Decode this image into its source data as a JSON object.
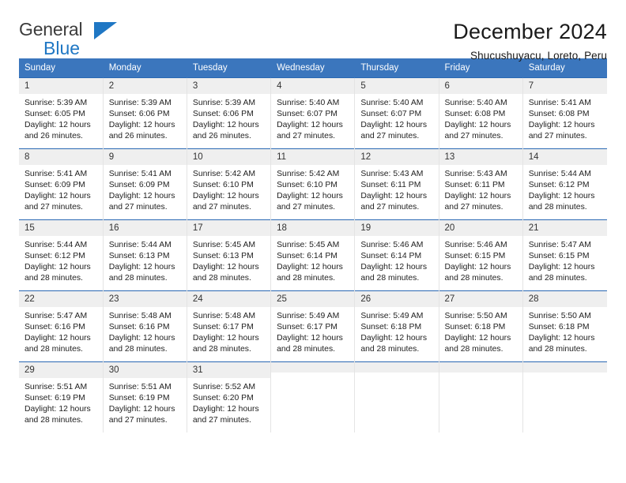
{
  "brand": {
    "name_top": "General",
    "name_bottom": "Blue",
    "accent_color": "#1f77c4"
  },
  "header": {
    "title": "December 2024",
    "subtitle": "Shucushuyacu, Loreto, Peru"
  },
  "theme": {
    "header_row_bg": "#3b76bd",
    "header_row_text": "#ffffff",
    "row_top_border": "#2a68b3",
    "daynum_bg": "#efefef"
  },
  "calendar": {
    "weekday_headers": [
      "Sunday",
      "Monday",
      "Tuesday",
      "Wednesday",
      "Thursday",
      "Friday",
      "Saturday"
    ],
    "weeks": [
      [
        {
          "day": "1",
          "sunrise": "Sunrise: 5:39 AM",
          "sunset": "Sunset: 6:05 PM",
          "daylight": "Daylight: 12 hours and 26 minutes."
        },
        {
          "day": "2",
          "sunrise": "Sunrise: 5:39 AM",
          "sunset": "Sunset: 6:06 PM",
          "daylight": "Daylight: 12 hours and 26 minutes."
        },
        {
          "day": "3",
          "sunrise": "Sunrise: 5:39 AM",
          "sunset": "Sunset: 6:06 PM",
          "daylight": "Daylight: 12 hours and 26 minutes."
        },
        {
          "day": "4",
          "sunrise": "Sunrise: 5:40 AM",
          "sunset": "Sunset: 6:07 PM",
          "daylight": "Daylight: 12 hours and 27 minutes."
        },
        {
          "day": "5",
          "sunrise": "Sunrise: 5:40 AM",
          "sunset": "Sunset: 6:07 PM",
          "daylight": "Daylight: 12 hours and 27 minutes."
        },
        {
          "day": "6",
          "sunrise": "Sunrise: 5:40 AM",
          "sunset": "Sunset: 6:08 PM",
          "daylight": "Daylight: 12 hours and 27 minutes."
        },
        {
          "day": "7",
          "sunrise": "Sunrise: 5:41 AM",
          "sunset": "Sunset: 6:08 PM",
          "daylight": "Daylight: 12 hours and 27 minutes."
        }
      ],
      [
        {
          "day": "8",
          "sunrise": "Sunrise: 5:41 AM",
          "sunset": "Sunset: 6:09 PM",
          "daylight": "Daylight: 12 hours and 27 minutes."
        },
        {
          "day": "9",
          "sunrise": "Sunrise: 5:41 AM",
          "sunset": "Sunset: 6:09 PM",
          "daylight": "Daylight: 12 hours and 27 minutes."
        },
        {
          "day": "10",
          "sunrise": "Sunrise: 5:42 AM",
          "sunset": "Sunset: 6:10 PM",
          "daylight": "Daylight: 12 hours and 27 minutes."
        },
        {
          "day": "11",
          "sunrise": "Sunrise: 5:42 AM",
          "sunset": "Sunset: 6:10 PM",
          "daylight": "Daylight: 12 hours and 27 minutes."
        },
        {
          "day": "12",
          "sunrise": "Sunrise: 5:43 AM",
          "sunset": "Sunset: 6:11 PM",
          "daylight": "Daylight: 12 hours and 27 minutes."
        },
        {
          "day": "13",
          "sunrise": "Sunrise: 5:43 AM",
          "sunset": "Sunset: 6:11 PM",
          "daylight": "Daylight: 12 hours and 27 minutes."
        },
        {
          "day": "14",
          "sunrise": "Sunrise: 5:44 AM",
          "sunset": "Sunset: 6:12 PM",
          "daylight": "Daylight: 12 hours and 28 minutes."
        }
      ],
      [
        {
          "day": "15",
          "sunrise": "Sunrise: 5:44 AM",
          "sunset": "Sunset: 6:12 PM",
          "daylight": "Daylight: 12 hours and 28 minutes."
        },
        {
          "day": "16",
          "sunrise": "Sunrise: 5:44 AM",
          "sunset": "Sunset: 6:13 PM",
          "daylight": "Daylight: 12 hours and 28 minutes."
        },
        {
          "day": "17",
          "sunrise": "Sunrise: 5:45 AM",
          "sunset": "Sunset: 6:13 PM",
          "daylight": "Daylight: 12 hours and 28 minutes."
        },
        {
          "day": "18",
          "sunrise": "Sunrise: 5:45 AM",
          "sunset": "Sunset: 6:14 PM",
          "daylight": "Daylight: 12 hours and 28 minutes."
        },
        {
          "day": "19",
          "sunrise": "Sunrise: 5:46 AM",
          "sunset": "Sunset: 6:14 PM",
          "daylight": "Daylight: 12 hours and 28 minutes."
        },
        {
          "day": "20",
          "sunrise": "Sunrise: 5:46 AM",
          "sunset": "Sunset: 6:15 PM",
          "daylight": "Daylight: 12 hours and 28 minutes."
        },
        {
          "day": "21",
          "sunrise": "Sunrise: 5:47 AM",
          "sunset": "Sunset: 6:15 PM",
          "daylight": "Daylight: 12 hours and 28 minutes."
        }
      ],
      [
        {
          "day": "22",
          "sunrise": "Sunrise: 5:47 AM",
          "sunset": "Sunset: 6:16 PM",
          "daylight": "Daylight: 12 hours and 28 minutes."
        },
        {
          "day": "23",
          "sunrise": "Sunrise: 5:48 AM",
          "sunset": "Sunset: 6:16 PM",
          "daylight": "Daylight: 12 hours and 28 minutes."
        },
        {
          "day": "24",
          "sunrise": "Sunrise: 5:48 AM",
          "sunset": "Sunset: 6:17 PM",
          "daylight": "Daylight: 12 hours and 28 minutes."
        },
        {
          "day": "25",
          "sunrise": "Sunrise: 5:49 AM",
          "sunset": "Sunset: 6:17 PM",
          "daylight": "Daylight: 12 hours and 28 minutes."
        },
        {
          "day": "26",
          "sunrise": "Sunrise: 5:49 AM",
          "sunset": "Sunset: 6:18 PM",
          "daylight": "Daylight: 12 hours and 28 minutes."
        },
        {
          "day": "27",
          "sunrise": "Sunrise: 5:50 AM",
          "sunset": "Sunset: 6:18 PM",
          "daylight": "Daylight: 12 hours and 28 minutes."
        },
        {
          "day": "28",
          "sunrise": "Sunrise: 5:50 AM",
          "sunset": "Sunset: 6:18 PM",
          "daylight": "Daylight: 12 hours and 28 minutes."
        }
      ],
      [
        {
          "day": "29",
          "sunrise": "Sunrise: 5:51 AM",
          "sunset": "Sunset: 6:19 PM",
          "daylight": "Daylight: 12 hours and 28 minutes."
        },
        {
          "day": "30",
          "sunrise": "Sunrise: 5:51 AM",
          "sunset": "Sunset: 6:19 PM",
          "daylight": "Daylight: 12 hours and 27 minutes."
        },
        {
          "day": "31",
          "sunrise": "Sunrise: 5:52 AM",
          "sunset": "Sunset: 6:20 PM",
          "daylight": "Daylight: 12 hours and 27 minutes."
        },
        {
          "day": "",
          "sunrise": "",
          "sunset": "",
          "daylight": ""
        },
        {
          "day": "",
          "sunrise": "",
          "sunset": "",
          "daylight": ""
        },
        {
          "day": "",
          "sunrise": "",
          "sunset": "",
          "daylight": ""
        },
        {
          "day": "",
          "sunrise": "",
          "sunset": "",
          "daylight": ""
        }
      ]
    ]
  }
}
